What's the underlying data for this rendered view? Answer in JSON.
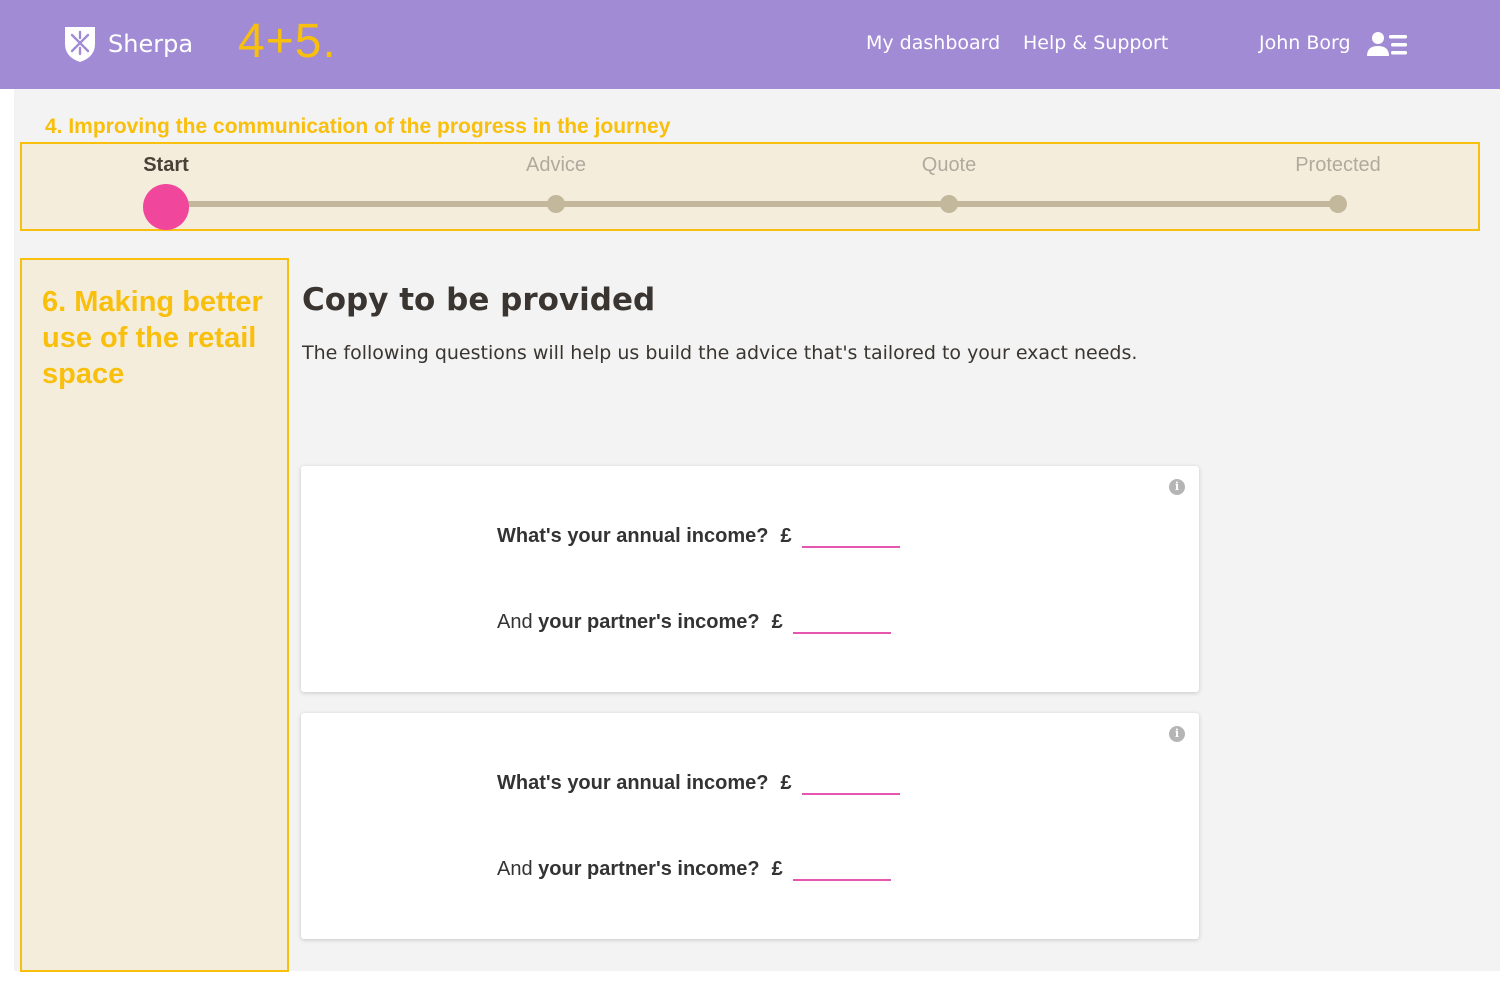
{
  "header": {
    "brand": "Sherpa",
    "overlay": "4+5.",
    "nav": [
      {
        "label": "My dashboard"
      },
      {
        "label": "Help & Support"
      }
    ],
    "user_name": "John Borg"
  },
  "annotations": {
    "top": "4. Improving the communication of the progress in the journey",
    "side": "6. Making better use of the retail space"
  },
  "progress": {
    "steps": [
      {
        "label": "Start",
        "active": true
      },
      {
        "label": "Advice",
        "active": false
      },
      {
        "label": "Quote",
        "active": false
      },
      {
        "label": "Protected",
        "active": false
      }
    ]
  },
  "main": {
    "title": "Copy to be provided",
    "description": "The following questions will help us build the advice that's tailored to your exact needs."
  },
  "cards": [
    {
      "q1": "What's your annual income?",
      "q2_prefix": "And ",
      "q2_bold": "your partner's income?",
      "currency": "£",
      "info": "i"
    },
    {
      "q1": "What's your annual income?",
      "q2_prefix": "And ",
      "q2_bold": "your partner's income?",
      "currency": "£",
      "info": "i"
    }
  ]
}
